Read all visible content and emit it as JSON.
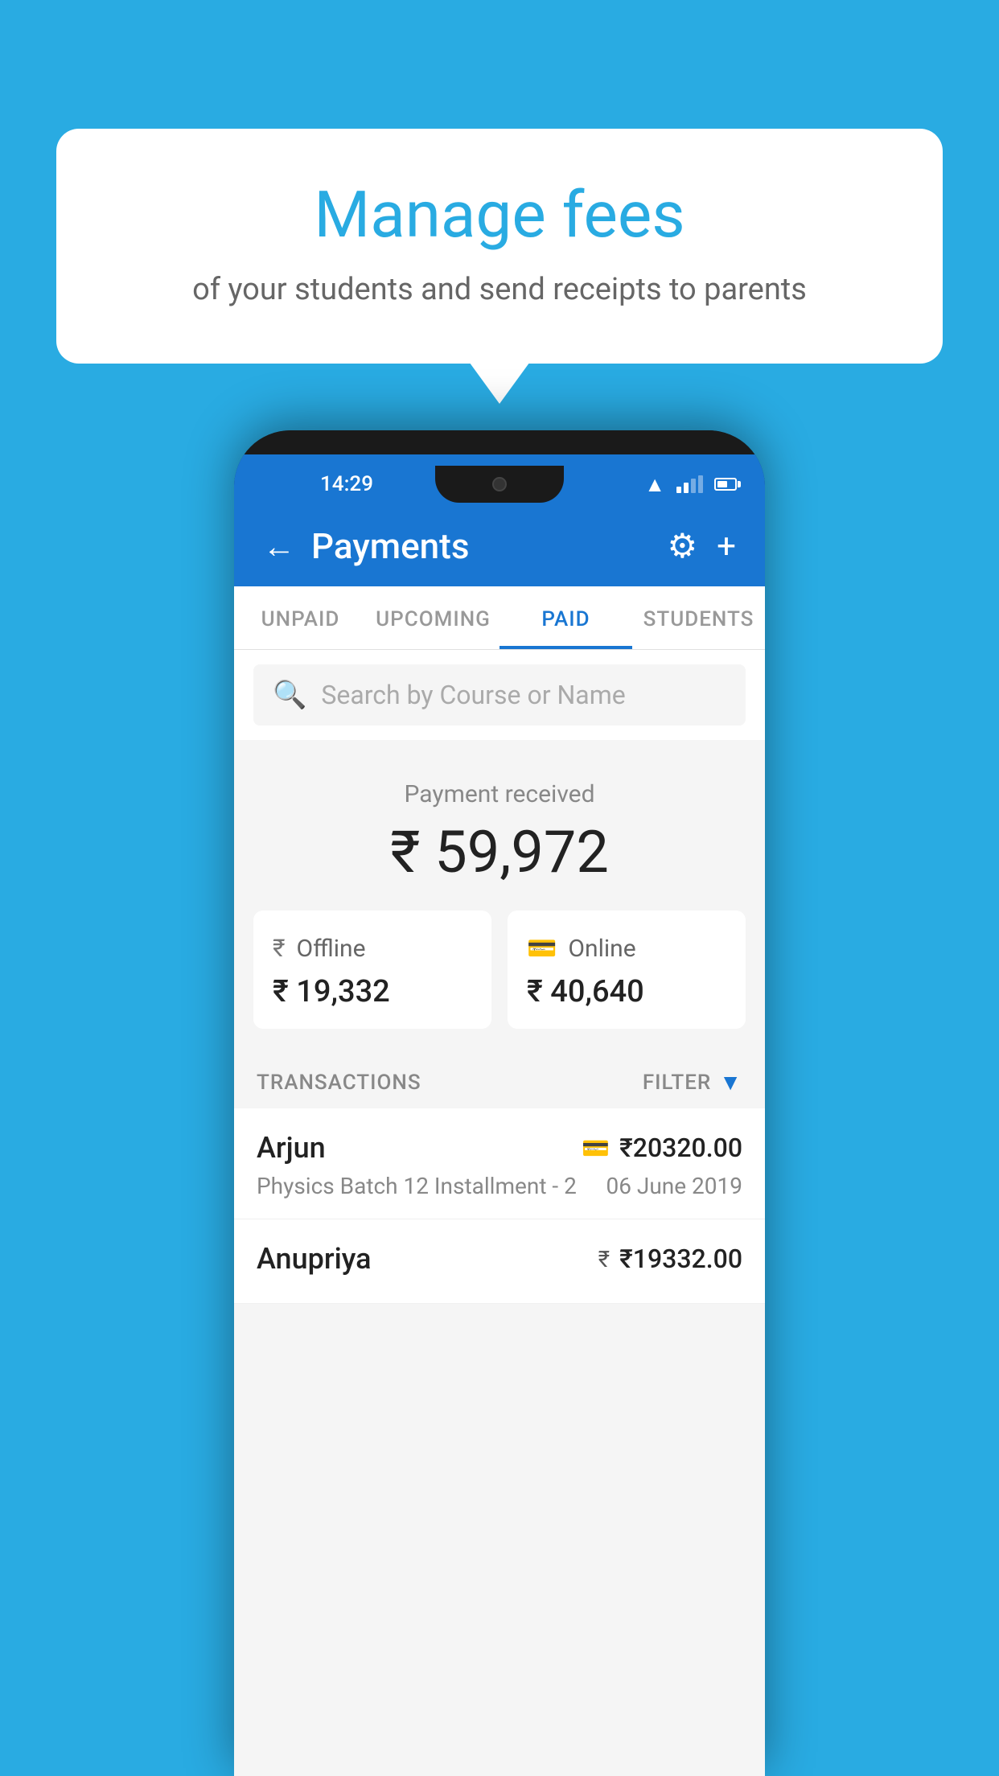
{
  "background_color": "#29abe2",
  "speech_bubble": {
    "title": "Manage fees",
    "subtitle": "of your students and send receipts to parents"
  },
  "phone": {
    "status_bar": {
      "time": "14:29"
    },
    "header": {
      "back_label": "←",
      "title": "Payments",
      "settings_icon": "⚙",
      "add_icon": "+"
    },
    "tabs": [
      {
        "label": "UNPAID",
        "active": false
      },
      {
        "label": "UPCOMING",
        "active": false
      },
      {
        "label": "PAID",
        "active": true
      },
      {
        "label": "STUDENTS",
        "active": false
      }
    ],
    "search": {
      "placeholder": "Search by Course or Name"
    },
    "payment_summary": {
      "label": "Payment received",
      "amount": "₹ 59,972"
    },
    "payment_cards": [
      {
        "label": "Offline",
        "amount": "₹ 19,332",
        "icon": "₹"
      },
      {
        "label": "Online",
        "amount": "₹ 40,640",
        "icon": "💳"
      }
    ],
    "transactions": {
      "header_label": "TRANSACTIONS",
      "filter_label": "FILTER",
      "items": [
        {
          "name": "Arjun",
          "course": "Physics Batch 12 Installment - 2",
          "amount": "₹20320.00",
          "date": "06 June 2019",
          "payment_type": "online"
        },
        {
          "name": "Anupriya",
          "course": "",
          "amount": "₹19332.00",
          "date": "",
          "payment_type": "offline"
        }
      ]
    }
  }
}
